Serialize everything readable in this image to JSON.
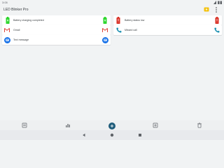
{
  "status_bar": {
    "time": "3:05"
  },
  "app_bar": {
    "title": "LED Blinker Pro"
  },
  "left_column": [
    {
      "label": "Battery charging completed",
      "left_icon": "battery-charging-icon",
      "right_icon": "battery-charging-icon",
      "accent": "#2bd62b"
    },
    {
      "label": "Gmail",
      "left_icon": "gmail-icon",
      "right_icon": "gmail-icon",
      "accent": "#d93025"
    },
    {
      "label": "Text message",
      "left_icon": "message-icon",
      "right_icon": "message-icon",
      "accent": "#1a73e8"
    }
  ],
  "right_column": [
    {
      "label": "Battery status low",
      "left_icon": "battery-low-icon",
      "right_icon": "battery-low-icon",
      "accent": "#d93025"
    },
    {
      "label": "Missed call",
      "left_icon": "phone-icon",
      "right_icon": "phone-icon",
      "accent": "#1a8fb0"
    }
  ],
  "bottom_nav": [
    "list-icon",
    "chart-icon",
    "add-icon",
    "add-box-icon",
    "trash-icon"
  ],
  "colors": {
    "background": "#f1f3f4",
    "fab": "#1f5c7a",
    "bolt": "#f4c20d"
  }
}
